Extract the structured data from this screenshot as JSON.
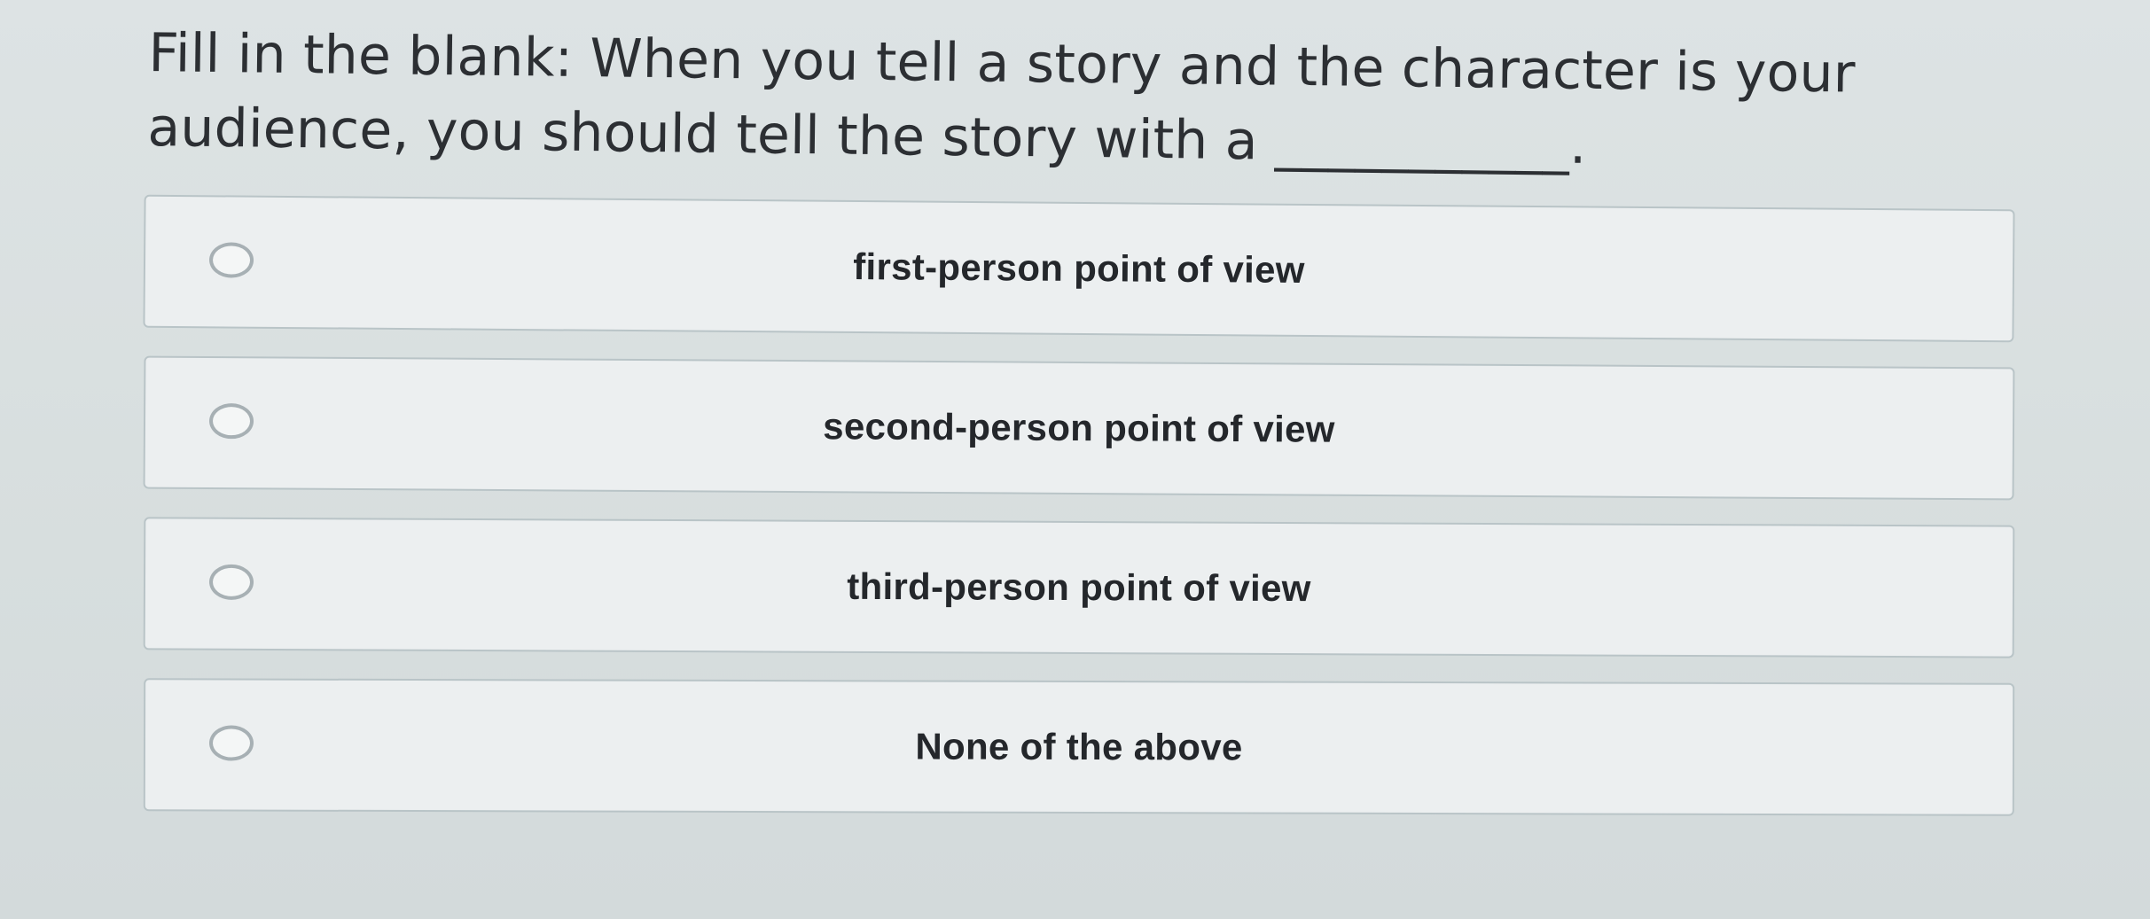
{
  "question": {
    "text": "Fill in the blank: When you tell a story and the character is your audience, you should tell the story with a ___________."
  },
  "options": [
    {
      "label": "first-person point of view"
    },
    {
      "label": "second-person point of view"
    },
    {
      "label": "third-person point of view"
    },
    {
      "label": "None of the above"
    }
  ]
}
